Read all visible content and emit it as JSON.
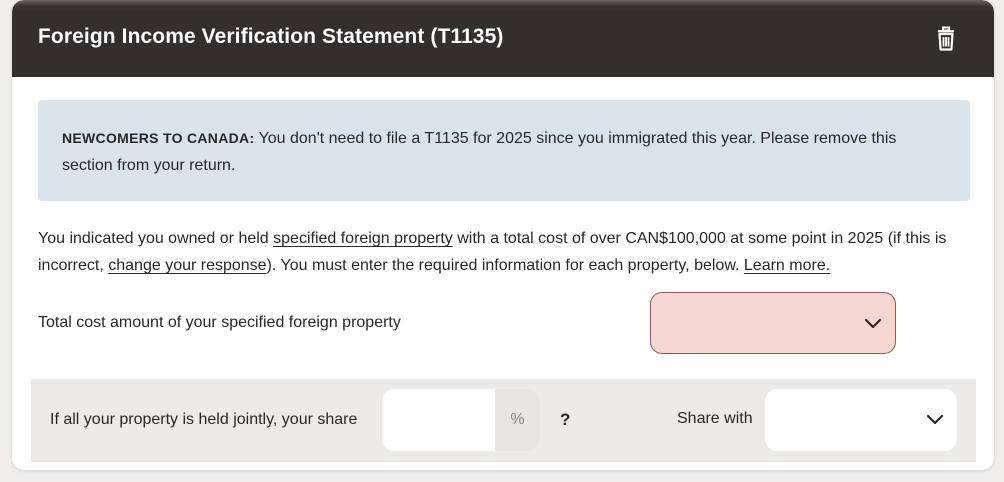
{
  "header": {
    "title": "Foreign Income Verification Statement (T1135)"
  },
  "notice": {
    "strong": "NEWCOMERS TO CANADA:",
    "text": " You don't need to file a T1135 for 2025 since you immigrated this year. Please remove this section from your return."
  },
  "intro": {
    "part1": "You indicated you owned or held ",
    "link_property": "specified foreign property",
    "part2": " with a total cost of over CAN$100,000 at some point in 2025 (if this is incorrect, ",
    "link_change": "change your response",
    "part3": "). You must enter the required information for each property, below. ",
    "link_learn": "Learn more."
  },
  "cost": {
    "label": "Total cost amount of your specified foreign property",
    "value": ""
  },
  "joint": {
    "label": "If all your property is held jointly, your share",
    "share_value": "",
    "percent_symbol": "%",
    "help_symbol": "?",
    "share_with_label": "Share with",
    "share_with_value": ""
  },
  "colors": {
    "header_bg": "#332f2e",
    "notice_bg": "#d8e3ec",
    "error_bg": "#f7d7d2",
    "error_border": "#9c5a4e",
    "joint_bg": "#ecebea"
  }
}
